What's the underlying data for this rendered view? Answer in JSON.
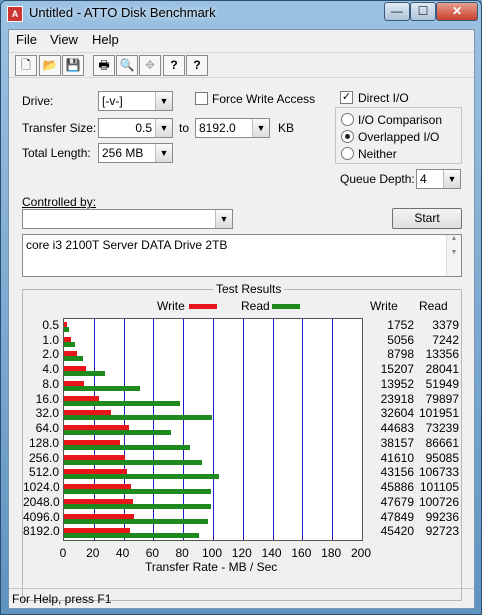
{
  "window": {
    "title": "Untitled - ATTO Disk Benchmark",
    "minimize": "—",
    "maximize": "☐",
    "close": "✕"
  },
  "menu": [
    "File",
    "View",
    "Help"
  ],
  "toolbar": {
    "icons": [
      "new-icon",
      "open-icon",
      "save-icon",
      "print-icon",
      "print-preview-icon",
      "move-icon",
      "help-icon",
      "context-help-icon"
    ],
    "glyphs": [
      "🗋",
      "📂",
      "💾",
      "🖶",
      "🔍",
      "✥",
      "?",
      "?"
    ]
  },
  "form": {
    "drive_label": "Drive:",
    "drive_value": "[-v-]",
    "force_write_label": "Force Write Access",
    "force_write_checked": false,
    "direct_io_label": "Direct I/O",
    "direct_io_checked": true,
    "transfer_size_label": "Transfer Size:",
    "transfer_from": "0.5",
    "to_label": "to",
    "transfer_to": "8192.0",
    "kb_label": "KB",
    "total_length_label": "Total Length:",
    "total_length_value": "256 MB",
    "io_comparison": "I/O Comparison",
    "overlapped_io": "Overlapped I/O",
    "neither": "Neither",
    "selected_mode": "overlapped",
    "queue_depth_label": "Queue Depth:",
    "queue_depth_value": "4",
    "controlled_by_label": "Controlled by:",
    "controlled_by_value": "",
    "start_button": "Start",
    "description": "core i3 2100T Server DATA Drive 2TB"
  },
  "results": {
    "title": "Test Results",
    "legend_write": "Write",
    "legend_read": "Read",
    "col_write": "Write",
    "col_read": "Read",
    "xlabel": "Transfer Rate - MB / Sec",
    "colors": {
      "write": "#e8151b",
      "read": "#1e8a1e"
    }
  },
  "chart_data": {
    "type": "bar",
    "orientation": "horizontal",
    "categories": [
      "0.5",
      "1.0",
      "2.0",
      "4.0",
      "8.0",
      "16.0",
      "32.0",
      "64.0",
      "128.0",
      "256.0",
      "512.0",
      "1024.0",
      "2048.0",
      "4096.0",
      "8192.0"
    ],
    "series": [
      {
        "name": "Write",
        "values_kb": [
          1752,
          5056,
          8798,
          15207,
          13952,
          23918,
          32604,
          44683,
          38157,
          41610,
          43156,
          45886,
          47679,
          47849,
          45420
        ]
      },
      {
        "name": "Read",
        "values_kb": [
          3379,
          7242,
          13356,
          28041,
          51949,
          79897,
          101951,
          73239,
          86661,
          95085,
          106733,
          101105,
          100726,
          99236,
          92723
        ]
      }
    ],
    "xlabel": "Transfer Rate - MB / Sec",
    "xticks": [
      "0",
      "20",
      "40",
      "60",
      "80",
      "100",
      "120",
      "140",
      "160",
      "180",
      "200"
    ],
    "xlim": [
      0,
      200
    ]
  },
  "status": "For Help, press F1"
}
